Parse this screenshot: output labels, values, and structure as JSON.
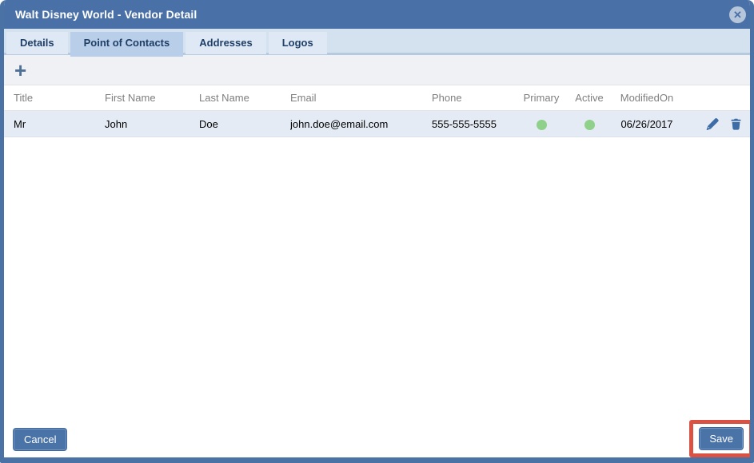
{
  "window": {
    "title": "Walt Disney World - Vendor Detail"
  },
  "icons": {
    "close": "✕",
    "add": "+"
  },
  "tabs": [
    {
      "label": "Details",
      "active": false
    },
    {
      "label": "Point of Contacts",
      "active": true
    },
    {
      "label": "Addresses",
      "active": false
    },
    {
      "label": "Logos",
      "active": false
    }
  ],
  "grid": {
    "columns": [
      "Title",
      "First Name",
      "Last Name",
      "Email",
      "Phone",
      "Primary",
      "Active",
      "ModifiedOn"
    ],
    "rows": [
      {
        "title": "Mr",
        "first_name": "John",
        "last_name": "Doe",
        "email": "john.doe@email.com",
        "phone": "555-555-5555",
        "primary": true,
        "active": true,
        "modified_on": "06/26/2017"
      }
    ]
  },
  "footer": {
    "cancel_label": "Cancel",
    "save_label": "Save"
  },
  "colors": {
    "titlebar": "#4a71a7",
    "tab_text": "#1f3f66",
    "active_tab_bg": "#b9cee8",
    "status_dot_green": "#8fd08b",
    "save_highlight": "#d95243",
    "button_bg": "#4a73a8",
    "icon_blue": "#3d6ca6"
  }
}
